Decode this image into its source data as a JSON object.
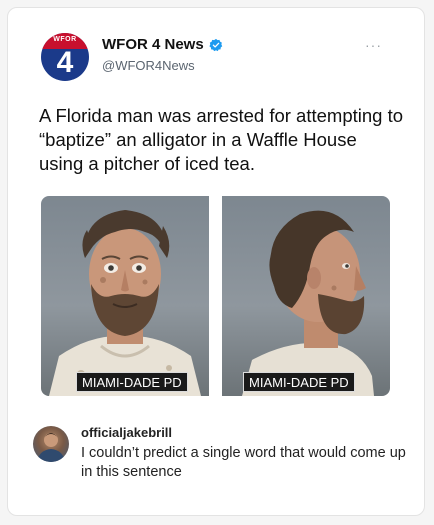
{
  "post": {
    "account": {
      "display_name": "WFOR 4 News",
      "handle": "@WFOR4News",
      "avatar_brand": "WFOR",
      "avatar_digit": "4",
      "verified_icon": "verified-badge-icon",
      "verified_color": "#1d9bf0"
    },
    "more_label": "···",
    "text": "A Florida man was arrested for attempting to “baptize” an alligator in a Waffle House using a pitcher of iced tea.",
    "photos": [
      {
        "icon": "mugshot-front-photo",
        "label": "MIAMI-DADE PD"
      },
      {
        "icon": "mugshot-profile-photo",
        "label": "MIAMI-DADE PD"
      }
    ]
  },
  "reply": {
    "username": "officialjakebrill",
    "text": "I couldn’t predict a single word that would come up in this sentence"
  },
  "colors": {
    "brand_red": "#c8102e",
    "brand_blue": "#1b3a8a",
    "text": "#111111",
    "muted": "#5b6570"
  }
}
